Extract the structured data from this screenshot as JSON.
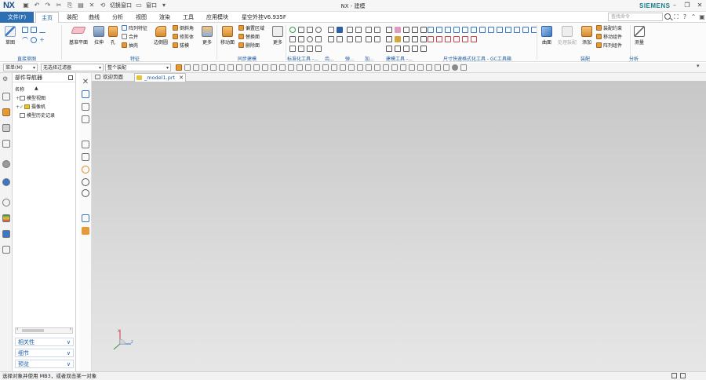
{
  "app": {
    "logo": "NX",
    "window_title": "NX - 建模",
    "brand": "SIEMENS"
  },
  "quick_access": {
    "switch_window": "切换窗口",
    "window": "窗口"
  },
  "menu": {
    "tabs": [
      "文件(F)",
      "主页",
      "装配",
      "曲线",
      "分析",
      "视图",
      "渲染",
      "工具",
      "应用模块",
      "星空外挂V6.935F"
    ],
    "search_placeholder": "查找命令"
  },
  "ribbon": {
    "groups": [
      {
        "label": "直接草图"
      },
      {
        "label": "特征"
      },
      {
        "label": "同步建模"
      },
      {
        "label": "标准化工具 -..."
      },
      {
        "label": "齿..."
      },
      {
        "label": "弹..."
      },
      {
        "label": "加..."
      },
      {
        "label": "建模工具 -..."
      },
      {
        "label": "尺寸快速格式化工具 - GC工具箱"
      },
      {
        "label": "装配"
      },
      {
        "label": "分析"
      }
    ],
    "buttons": {
      "sketch": "草图",
      "datum_plane": "基准平面",
      "extrude": "拉伸",
      "hole": "孔",
      "pattern_feature": "阵列特征",
      "unite": "合并",
      "shell": "抽壳",
      "edge_blend": "边倒圆",
      "chamfer": "倒斜角",
      "trim_body": "修剪体",
      "draft": "拔模",
      "more_feature": "更多",
      "move_face": "移动面",
      "offset_region": "偏置区域",
      "replace_face": "替换面",
      "delete_face": "删除面",
      "more_sync": "更多",
      "surface": "曲面",
      "wave_link": "处理装配",
      "add": "添加",
      "assembly_constraint": "装配约束",
      "move_component": "移动组件",
      "pattern_component": "阵列组件",
      "measure": "测量"
    }
  },
  "toolbar2": {
    "menu": "菜单(M)",
    "filter": "无选择过滤器",
    "scope": "整个装配"
  },
  "navigator": {
    "title": "部件导航器",
    "column": "名称",
    "sort": "▲",
    "items": [
      {
        "expander": "+",
        "label": "模型视图"
      },
      {
        "expander": "+",
        "label": "摄像机"
      },
      {
        "expander": "",
        "label": "模型历史记录"
      }
    ],
    "sections": [
      "相关性",
      "细节",
      "预览"
    ]
  },
  "doc_tabs": {
    "welcome": "欢迎页面",
    "model": "_model1.prt"
  },
  "status": {
    "text": "选择对象并使用 MB3，或者双击某一对象"
  }
}
